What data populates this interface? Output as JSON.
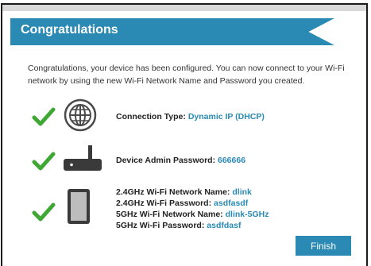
{
  "header": {
    "title": "Congratulations"
  },
  "intro": "Congratulations, your device has been configured. You can now connect to your Wi-Fi network by using the new Wi-Fi Network Name and Password you created.",
  "connection": {
    "label": "Connection Type:",
    "value": "Dynamic IP (DHCP)"
  },
  "admin": {
    "label": "Device Admin Password:",
    "value": "666666"
  },
  "wifi": {
    "name_24_label": "2.4GHz Wi-Fi Network Name:",
    "name_24_value": "dlink",
    "pass_24_label": "2.4GHz Wi-Fi Password:",
    "pass_24_value": "asdfasdf",
    "name_5_label": "5GHz Wi-Fi Network Name:",
    "name_5_value": "dlink-5GHz",
    "pass_5_label": "5GHz Wi-Fi Password:",
    "pass_5_value": "asdfdasf"
  },
  "actions": {
    "finish_label": "Finish"
  },
  "colors": {
    "accent": "#2a8ab4",
    "check": "#3fa733"
  },
  "icons": [
    "check-icon",
    "globe-icon",
    "router-icon",
    "tablet-icon"
  ]
}
